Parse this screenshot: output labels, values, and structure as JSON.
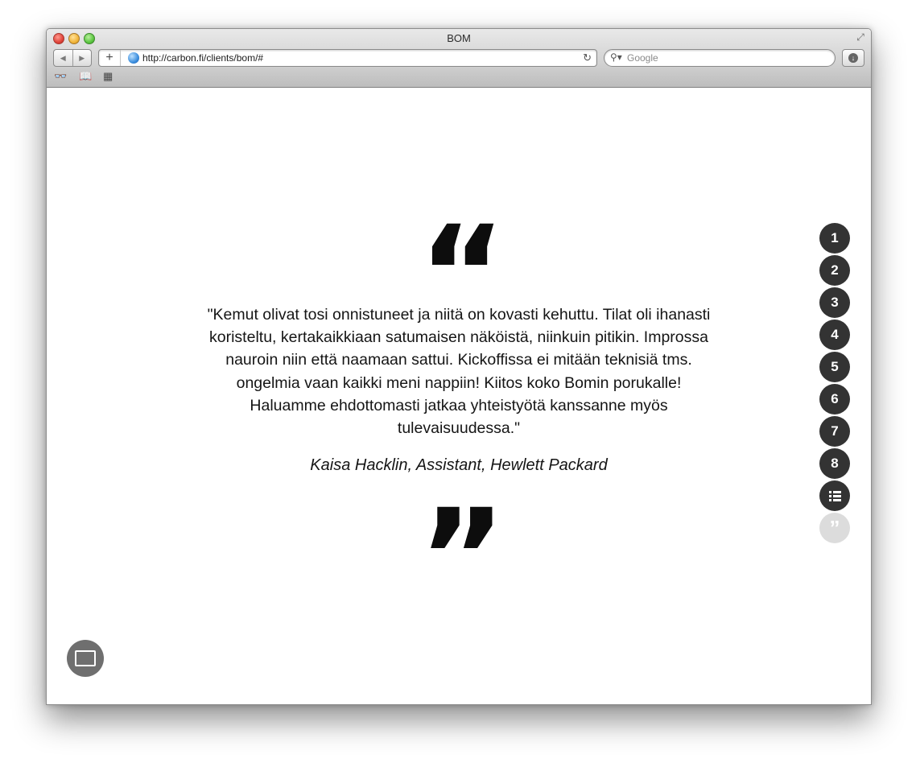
{
  "window": {
    "title": "BOM"
  },
  "toolbar": {
    "back_icon": "back-arrow-icon",
    "forward_icon": "forward-arrow-icon",
    "add_label": "+",
    "url": "http://carbon.fi/clients/bom/#",
    "search_placeholder": "Google"
  },
  "bookmarks_bar": {
    "icons": [
      "reading-list-icon",
      "bookmarks-book-icon",
      "top-sites-grid-icon"
    ]
  },
  "quote": {
    "text": "\"Kemut olivat tosi onnistuneet ja niitä on kovasti kehuttu. Tilat oli ihanasti koristeltu, kertakaikkiaan satumaisen näköistä, niinkuin pitikin. Improssa nauroin niin että naamaan sattui. Kickoffissa ei mitään teknisiä tms. ongelmia vaan kaikki meni nappiin! Kiitos koko Bomin porukalle! Haluamme ehdottomasti jatkaa yhteistyötä kanssanne myös tulevaisuudessa.\"",
    "author": "Kaisa Hacklin, Assistant, Hewlett Packard",
    "open_mark": "“",
    "close_mark": "”"
  },
  "slide_nav": {
    "items": [
      "1",
      "2",
      "3",
      "4",
      "5",
      "6",
      "7",
      "8"
    ],
    "list_icon": "list-icon",
    "active_label": "”"
  },
  "colors": {
    "nav_dot": "#333333",
    "nav_dot_active": "#dcdcdc",
    "screen_button": "#6f6f6f"
  }
}
